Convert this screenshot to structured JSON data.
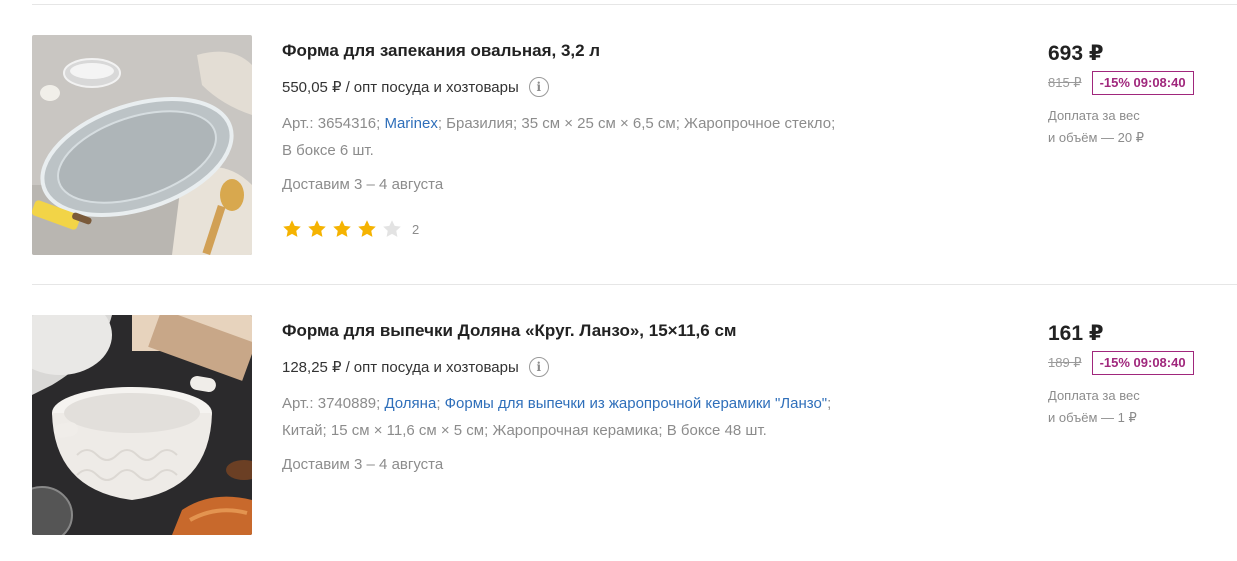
{
  "products": [
    {
      "title": "Форма для запекания овальная, 3,2 л",
      "opt_price": "550,05 ₽",
      "opt_separator": "/",
      "opt_category": "опт посуда и хозтовары",
      "specs_line1": {
        "article": "Арт.: 3654316;",
        "brand_link": "Marinex",
        "rest": "; Бразилия; 35 см × 25 см × 6,5 см; Жаропрочное стекло;"
      },
      "specs_line2": "В боксе 6 шт.",
      "delivery": "Доставим 3 – 4 августа",
      "rating": {
        "value": 4,
        "max": 5,
        "count": "2"
      },
      "price": "693 ₽",
      "old_price": "815 ₽",
      "discount": "-15% 09:08:40",
      "surcharge_line1": "Доплата за вес",
      "surcharge_line2": "и объём — 20 ₽"
    },
    {
      "title": "Форма для выпечки Доляна «Круг. Ланзо», 15×11,6 см",
      "opt_price": "128,25 ₽",
      "opt_separator": "/",
      "opt_category": "опт посуда и хозтовары",
      "specs_line1": {
        "article": "Арт.: 3740889;",
        "brand_link": "Доляна",
        "sep": ";",
        "collection_link": "Формы для выпечки из жаропрочной керамики \"Ланзо\"",
        "end": ";"
      },
      "specs_line2": "Китай; 15 см × 11,6 см × 5 см; Жаропрочная керамика; В боксе 48 шт.",
      "delivery": "Доставим 3 – 4 августа",
      "price": "161 ₽",
      "old_price": "189 ₽",
      "discount": "-15% 09:08:40",
      "surcharge_line1": "Доплата за вес",
      "surcharge_line2": "и объём — 1 ₽"
    }
  ],
  "icons": {
    "info": "info-icon",
    "star_filled_color": "#f5b301",
    "star_empty_color": "#e3e3e3"
  },
  "colors": {
    "link": "#2f6fba",
    "discount": "#a0277c"
  }
}
